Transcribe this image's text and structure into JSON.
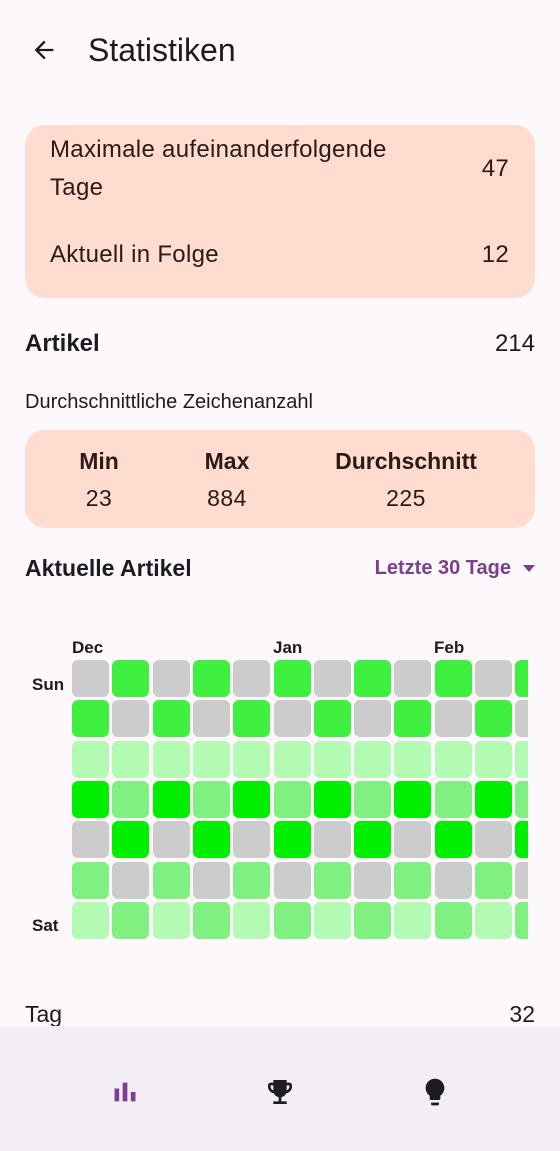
{
  "appbar": {
    "title": "Statistiken",
    "back_icon": "arrow-back-icon"
  },
  "streaks": {
    "max_label": "Maximale aufeinanderfolgende Tage",
    "max_value": "47",
    "current_label": "Aktuell in Folge",
    "current_value": "12"
  },
  "articles": {
    "label": "Artikel",
    "value": "214"
  },
  "char_count": {
    "heading": "Durchschnittliche Zeichenanzahl",
    "min_label": "Min",
    "min_value": "23",
    "max_label": "Max",
    "max_value": "884",
    "avg_label": "Durchschnitt",
    "avg_value": "225"
  },
  "recent": {
    "title": "Aktuelle Artikel",
    "range_selected": "Letzte 30 Tage",
    "months": [
      "Dec",
      "Jan",
      "Feb"
    ],
    "day_labels": [
      "Sun",
      "Sat"
    ],
    "colors": {
      "empty": "#cccccc",
      "level1": "#b3fab3",
      "level2": "#80f080",
      "level3": "#40f040",
      "level4": "#00ee00"
    },
    "grid_levels": [
      [
        0,
        3,
        0,
        3,
        0,
        3,
        0,
        3,
        0,
        3,
        0,
        3
      ],
      [
        3,
        0,
        3,
        0,
        3,
        0,
        3,
        0,
        3,
        0,
        3,
        0
      ],
      [
        1,
        1,
        1,
        1,
        1,
        1,
        1,
        1,
        1,
        1,
        1,
        1
      ],
      [
        4,
        2,
        4,
        2,
        4,
        2,
        4,
        2,
        4,
        2,
        4,
        2
      ],
      [
        0,
        4,
        0,
        4,
        0,
        4,
        0,
        4,
        0,
        4,
        0,
        4
      ],
      [
        2,
        0,
        2,
        0,
        2,
        0,
        2,
        0,
        2,
        0,
        2,
        0
      ],
      [
        1,
        2,
        1,
        2,
        1,
        2,
        1,
        2,
        1,
        2,
        1,
        2
      ]
    ]
  },
  "tag": {
    "label": "Tag",
    "value": "32"
  },
  "bottom_nav": {
    "items": [
      {
        "icon": "bar-chart-icon",
        "color": "#7b3f8f"
      },
      {
        "icon": "trophy-icon",
        "color": "#1d1b20"
      },
      {
        "icon": "lightbulb-icon",
        "color": "#1d1b20"
      }
    ]
  }
}
